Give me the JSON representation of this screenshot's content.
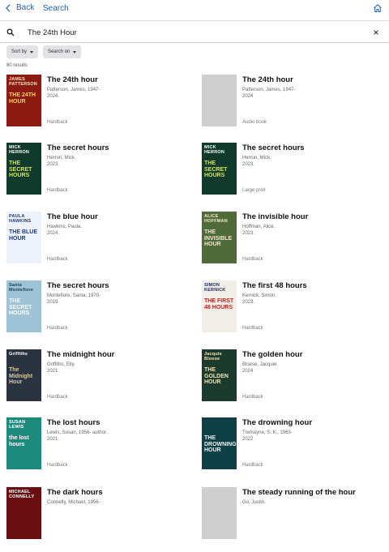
{
  "nav": {
    "back_label": "Back",
    "title": "Search"
  },
  "search": {
    "query": "The 24th Hour"
  },
  "filters": {
    "sort_label": "Sort by",
    "search_on_label": "Search on"
  },
  "results_count": "80 results",
  "results": [
    {
      "title": "The 24th hour",
      "author": "Patterson, James, 1947-",
      "year": "2024.",
      "format": "Hardback",
      "cover": {
        "bg": "#8a1a12",
        "top": "JAMES PATTERSON",
        "big": "THE 24TH HOUR",
        "top_color": "#f5e6c0",
        "big_color": "#ffd34a"
      }
    },
    {
      "title": "The 24th hour",
      "author": "Patterson, James, 1947-",
      "year": "2024",
      "format": "Audio book",
      "cover": null
    },
    {
      "title": "The secret hours",
      "author": "Herron, Mick.",
      "year": "2023.",
      "format": "Hardback",
      "cover": {
        "bg": "#0f3a2c",
        "top": "MICK HERRON",
        "big": "THE SECRET HOURS",
        "top_color": "#ffffff",
        "big_color": "#d7e34a"
      }
    },
    {
      "title": "The secret hours",
      "author": "Herron, Mick.",
      "year": "2023.",
      "format": "Large print",
      "cover": {
        "bg": "#0f3a2c",
        "top": "MICK HERRON",
        "big": "THE SECRET HOURS",
        "top_color": "#ffffff",
        "big_color": "#d7e34a"
      }
    },
    {
      "title": "The blue hour",
      "author": "Hawkins, Paula.",
      "year": "2024.",
      "format": "Hardback",
      "cover": {
        "bg": "#eef3fb",
        "top": "PAULA HAWKINS",
        "big": "THE BLUE HOUR",
        "top_color": "#1a3b8c",
        "big_color": "#1a3b8c"
      }
    },
    {
      "title": "The invisible hour",
      "author": "Hoffman, Alice.",
      "year": "2023.",
      "format": "Hardback",
      "cover": {
        "bg": "#4f6b3a",
        "top": "ALICE HOFFMAN",
        "big": "THE INVISIBLE HOUR",
        "top_color": "#f3e7d0",
        "big_color": "#f3e7d0"
      }
    },
    {
      "title": "The secret hours",
      "author": "Montefiore, Santa, 1970-",
      "year": "2019.",
      "format": "Hardback",
      "cover": {
        "bg": "#9fc3d6",
        "top": "Santa Montefiore",
        "big": "THE SECRET HOURS",
        "top_color": "#1c3d55",
        "big_color": "#ffffff"
      }
    },
    {
      "title": "The first 48 hours",
      "author": "Kernick, Simon.",
      "year": "2023.",
      "format": "Hardback",
      "cover": {
        "bg": "#f1eee8",
        "top": "SIMON KERNICK",
        "big": "THE FIRST 48 HOURS",
        "top_color": "#1a2a6c",
        "big_color": "#d0201a"
      }
    },
    {
      "title": "The midnight hour",
      "author": "Griffiths, Elly.",
      "year": "2021.",
      "format": "Hardback",
      "cover": {
        "bg": "#2a3440",
        "top": "Griffiths",
        "big": "The Midnight Hour",
        "top_color": "#ffffff",
        "big_color": "#d9c9a0"
      }
    },
    {
      "title": "The golden hour",
      "author": "Bloese, Jacquie.",
      "year": "2024",
      "format": "Hardback",
      "cover": {
        "bg": "#1c3b2f",
        "top": "Jacquie Bloese",
        "big": "THE GOLDEN HOUR",
        "top_color": "#f3e3b0",
        "big_color": "#f3e3b0"
      }
    },
    {
      "title": "The lost hours",
      "author": "Lewis, Susan, 1956- author.",
      "year": "2021.",
      "format": "Hardback",
      "cover": {
        "bg": "#1d8a7e",
        "top": "SUSAN LEWIS",
        "big": "the lost hours",
        "top_color": "#ffffff",
        "big_color": "#ffffff"
      }
    },
    {
      "title": "The drowning hour",
      "author": "Tremayne, S. K., 1963-",
      "year": "2022",
      "format": "Hardback",
      "cover": {
        "bg": "#0f3f47",
        "top": "",
        "big": "THE DROWNING HOUR",
        "top_color": "#ffffff",
        "big_color": "#e9f4f0"
      }
    },
    {
      "title": "The dark hours",
      "author": "Connelly, Michael, 1956-",
      "year": "",
      "format": "",
      "cover": {
        "bg": "#6a0d10",
        "top": "MICHAEL CONNELLY",
        "big": "",
        "top_color": "#ffffff",
        "big_color": "#ffffff"
      }
    },
    {
      "title": "The steady running of the hour",
      "author": "Go, Justin.",
      "year": "",
      "format": "",
      "cover": null
    }
  ]
}
